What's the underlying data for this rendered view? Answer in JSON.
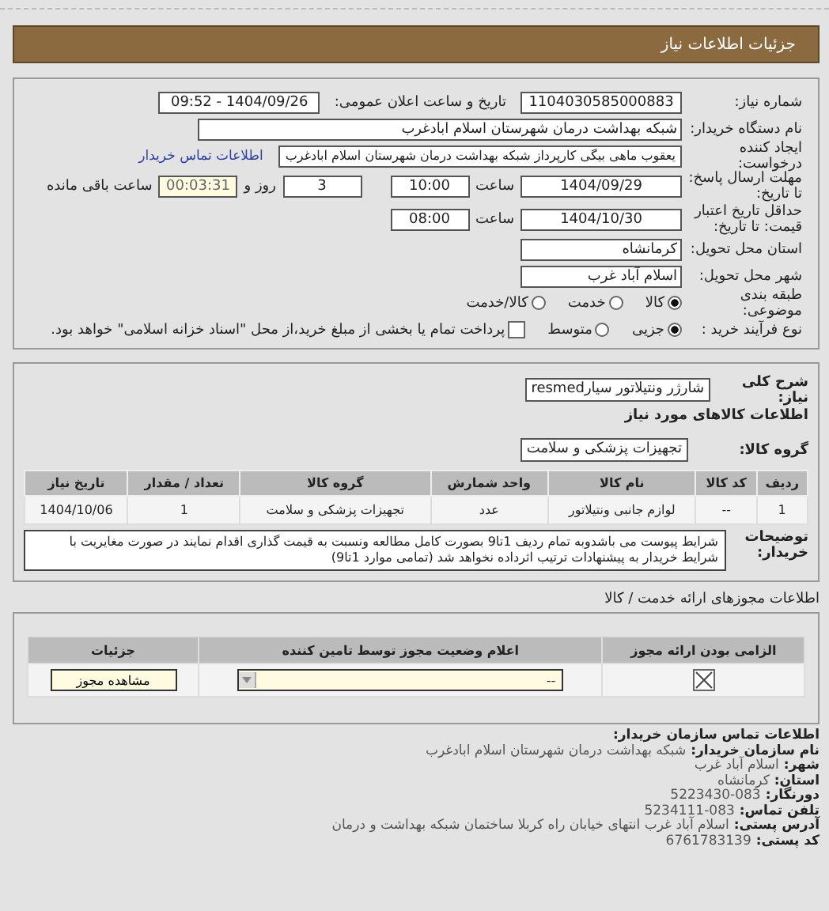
{
  "header": {
    "title": "جزئیات اطلاعات نیاز"
  },
  "need": {
    "number_label": "شماره نیاز:",
    "number": "1104030585000883",
    "announce_label": "تاریخ و ساعت اعلان عمومی:",
    "announce": "1404/09/26 - 09:52",
    "buyer_label": "نام دستگاه خریدار:",
    "buyer": "شبکه بهداشت درمان شهرستان اسلام ابادغرب",
    "creator_label": "ایجاد کننده درخواست:",
    "creator": "یعقوب ماهی بیگی کارپرداز شبکه بهداشت درمان شهرستان اسلام ابادغرب",
    "contact_link": "اطلاعات تماس خریدار",
    "deadline_label": "مهلت ارسال پاسخ: تا تاریخ:",
    "deadline_date": "1404/09/29",
    "time_label": "ساعت",
    "deadline_time": "10:00",
    "days": "3",
    "days_label": "روز و",
    "remaining": "00:03:31",
    "remaining_label": "ساعت باقی مانده",
    "validity_label": "حداقل تاریخ اعتبار قیمت: تا تاریخ:",
    "validity_date": "1404/10/30",
    "validity_time_label": "ساعت",
    "validity_time": "08:00",
    "province_label": "استان محل تحویل:",
    "province": "کرمانشاه",
    "city_label": "شهر محل تحویل:",
    "city": "اسلام آباد غرب",
    "category_label": "طبقه بندی موضوعی:",
    "category_options": [
      {
        "label": "کالا",
        "selected": true
      },
      {
        "label": "خدمت",
        "selected": false
      },
      {
        "label": "کالا/خدمت",
        "selected": false
      }
    ],
    "process_label": "نوع فرآیند خرید :",
    "process_options": [
      {
        "label": "جزیی",
        "selected": true
      },
      {
        "label": "متوسط",
        "selected": false
      }
    ],
    "treasury": {
      "checked": false,
      "text": "پرداخت تمام یا بخشی از مبلغ خرید،از محل \"اسناد خزانه اسلامی\" خواهد بود."
    }
  },
  "goods": {
    "summary_label": "شرح کلی نیاز:",
    "summary": "شارژر ونتیلاتور سیارresmed",
    "section_title": "اطلاعات کالاهای مورد نیاز",
    "group_label": "گروه کالا:",
    "group": "تجهیزات پزشکی و سلامت",
    "columns": [
      "ردیف",
      "کد کالا",
      "نام کالا",
      "واحد شمارش",
      "گروه کالا",
      "تعداد / مقدار",
      "تاریخ نیاز"
    ],
    "rows": [
      [
        "1",
        "--",
        "لوازم جانبی ونتیلاتور",
        "عدد",
        "تجهیزات پزشکی و سلامت",
        "1",
        "1404/10/06"
      ]
    ],
    "notes_label": "توضیحات خریدار:",
    "notes": "شرایط پیوست می باشدوبه تمام ردیف 1تا9 بصورت کامل مطالعه ونسبت به قیمت گذاری اقدام نمایند در صورت مغایریت با شرایط خریدار به پیشنهادات ترتیب اثرداده نخواهد شد (تمامی موارد 1تا9)"
  },
  "licenses": {
    "title": "اطلاعات مجوزهای ارائه خدمت / کالا",
    "columns": [
      "الزامی بودن ارائه مجوز",
      "اعلام وضعیت مجوز توسط تامین کننده",
      "جزئیات"
    ],
    "rows": [
      {
        "required": true,
        "status": "--",
        "button": "مشاهده مجوز"
      }
    ]
  },
  "contact": {
    "title": "اطلاعات تماس سازمان خریدار:",
    "lines": [
      {
        "label": "نام سازمان خریدار:",
        "value": "شبکه بهداشت درمان شهرستان اسلام ابادغرب"
      },
      {
        "label": "شهر:",
        "value": "اسلام آباد غرب"
      },
      {
        "label": "استان:",
        "value": "کرمانشاه"
      },
      {
        "label": "دورنگار:",
        "value": "083-5223430"
      },
      {
        "label": "تلفن تماس:",
        "value": "083-5234111"
      },
      {
        "label": "آدرس پستی:",
        "value": "اسلام آباد غرب انتهای خیابان راه کربلا ساختمان شبکه بهداشت و درمان"
      },
      {
        "label": "کد پستی:",
        "value": "6761783139"
      }
    ]
  }
}
